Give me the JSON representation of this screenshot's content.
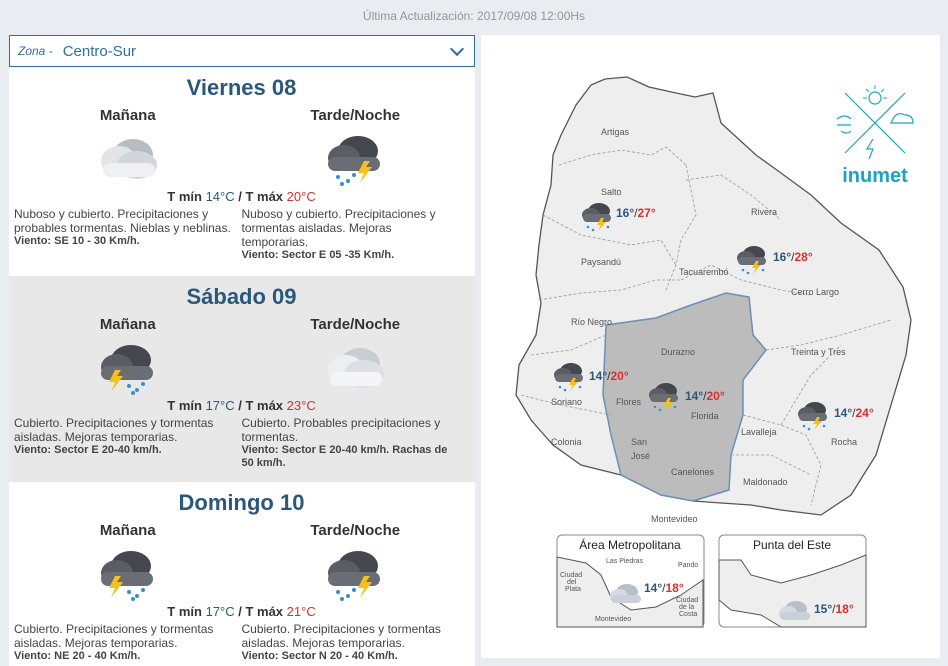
{
  "header": {
    "updated": "Última Actualización: 2017/09/08 12:00Hs"
  },
  "zone": {
    "label": "Zona -",
    "value": "Centro-Sur"
  },
  "days": [
    {
      "title": "Viernes 08",
      "temp_prefix_min": "T mín ",
      "tmin": "14°C",
      "sep": " / T máx ",
      "tmax": "20°C",
      "morning": {
        "label": "Mañana",
        "icon": "cloudy-icon",
        "desc": "Nuboso y cubierto. Precipitaciones y probables tormentas. Nieblas y neblinas.",
        "wind": "Viento: SE 10 - 30 Km/h."
      },
      "evening": {
        "label": "Tarde/Noche",
        "icon": "thunderstorm-icon",
        "desc": "Nuboso y cubierto. Precipitaciones y tormentas aisladas. Mejoras temporarias.",
        "wind": "Viento: Sector E 05 -35 Km/h."
      }
    },
    {
      "title": "Sábado 09",
      "temp_prefix_min": "T mín ",
      "tmin": "17°C",
      "sep": " / T máx ",
      "tmax": "23°C",
      "morning": {
        "label": "Mañana",
        "icon": "thunderstorm-icon",
        "desc": "Cubierto. Precipitaciones y tormentas aisladas. Mejoras temporarias.",
        "wind": "Viento: Sector E 20-40 km/h."
      },
      "evening": {
        "label": "Tarde/Noche",
        "icon": "cloudy-icon",
        "desc": "Cubierto. Probables precipitaciones y tormentas.",
        "wind": "Viento: Sector E 20-40 km/h. Rachas de 50 km/h."
      }
    },
    {
      "title": "Domingo 10",
      "temp_prefix_min": "T mín ",
      "tmin": "17°C",
      "sep": " / T máx ",
      "tmax": "21°C",
      "morning": {
        "label": "Mañana",
        "icon": "thunderstorm-icon",
        "desc": "Cubierto. Precipitaciones y tormentas aisladas. Mejoras temporarias.",
        "wind": "Viento: NE 20 - 40 Km/h."
      },
      "evening": {
        "label": "Tarde/Noche",
        "icon": "thunderstorm-icon",
        "desc": "Cubierto. Precipitaciones y tormentas aisladas. Mejoras temporarias.",
        "wind": "Viento: Sector N 20 - 40 Km/h."
      }
    }
  ],
  "map": {
    "brand": "inumet",
    "departments": [
      "Artigas",
      "Salto",
      "Rivera",
      "Paysandú",
      "Tacuarembó",
      "Cerro Largo",
      "Río Negro",
      "Durazno",
      "Treinta y Tres",
      "Soriano",
      "Flores",
      "Florida",
      "Lavalleja",
      "Rocha",
      "Colonia",
      "San",
      "José",
      "Canelones",
      "Maldonado",
      "Montevideo"
    ],
    "regions": [
      {
        "name": "north-west",
        "min": "16°",
        "max": "27°"
      },
      {
        "name": "north-east",
        "min": "16°",
        "max": "28°"
      },
      {
        "name": "south-west",
        "min": "14°",
        "max": "20°"
      },
      {
        "name": "centro-sur",
        "min": "14°",
        "max": "20°"
      },
      {
        "name": "east",
        "min": "14°",
        "max": "24°"
      }
    ],
    "metro": {
      "title": "Área Metropolitana",
      "min": "14°",
      "max": "18°",
      "labels": [
        "Las Piedras",
        "Pando",
        "Ciudad",
        "del",
        "Plata",
        "Ciudad",
        "de la",
        "Costa",
        "Montevideo"
      ]
    },
    "punta": {
      "title": "Punta del Este",
      "min": "15°",
      "max": "18°"
    }
  },
  "colors": {
    "accent": "#2b577a",
    "max": "#d9302d",
    "brand": "#1aa3c8"
  }
}
